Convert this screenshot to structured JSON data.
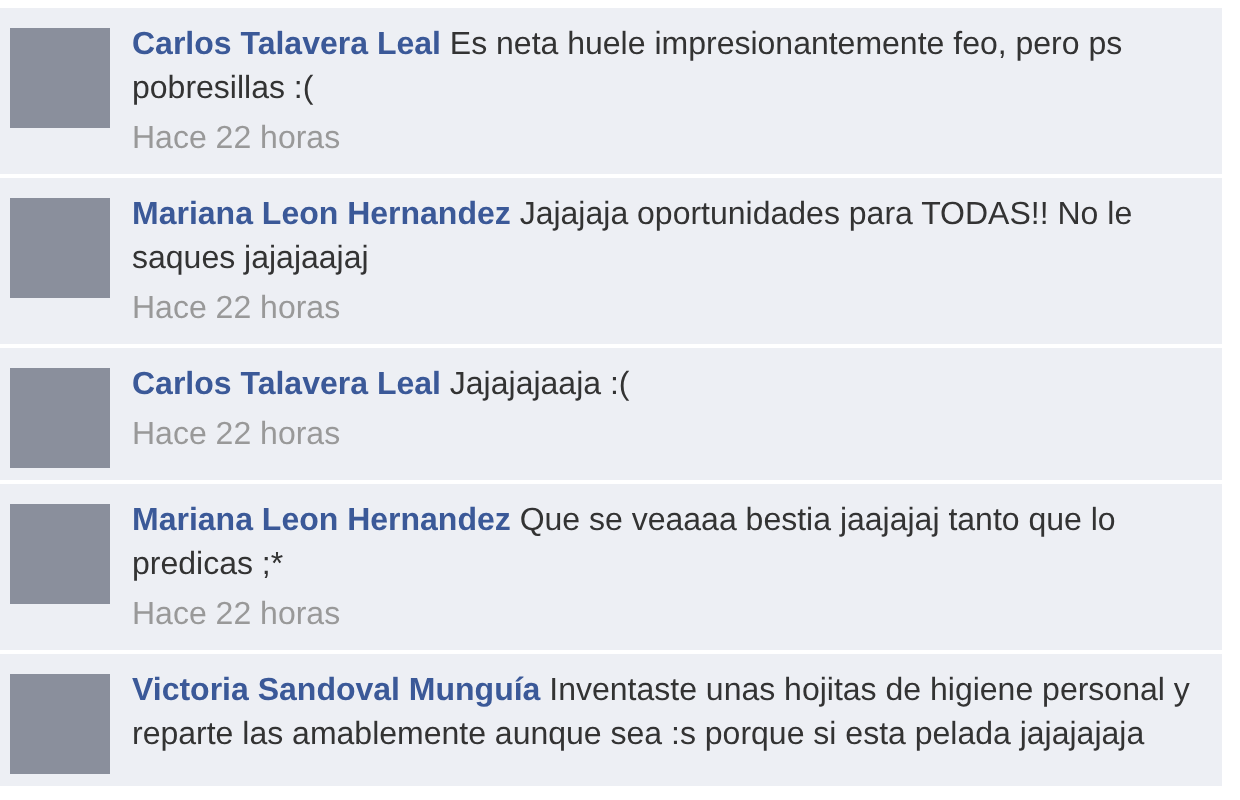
{
  "comments": [
    {
      "author": "Carlos Talavera Leal",
      "text": "Es neta huele impresionantemente feo, pero ps pobresillas :(",
      "time": "Hace 22 horas"
    },
    {
      "author": "Mariana Leon Hernandez",
      "text": "Jajajaja oportunidades para TODAS!! No le saques jajajaajaj",
      "time": "Hace 22 horas"
    },
    {
      "author": "Carlos Talavera Leal",
      "text": "Jajajajaaja :(",
      "time": "Hace 22 horas"
    },
    {
      "author": "Mariana Leon Hernandez",
      "text": "Que se veaaaa bestia jaajajaj tanto que lo predicas ;*",
      "time": "Hace 22 horas"
    },
    {
      "author": "Victoria Sandoval Munguía",
      "text": "Inventaste unas hojitas de higiene personal y reparte las amablemente aunque sea :s porque si esta pelada jajajajaja"
    }
  ]
}
